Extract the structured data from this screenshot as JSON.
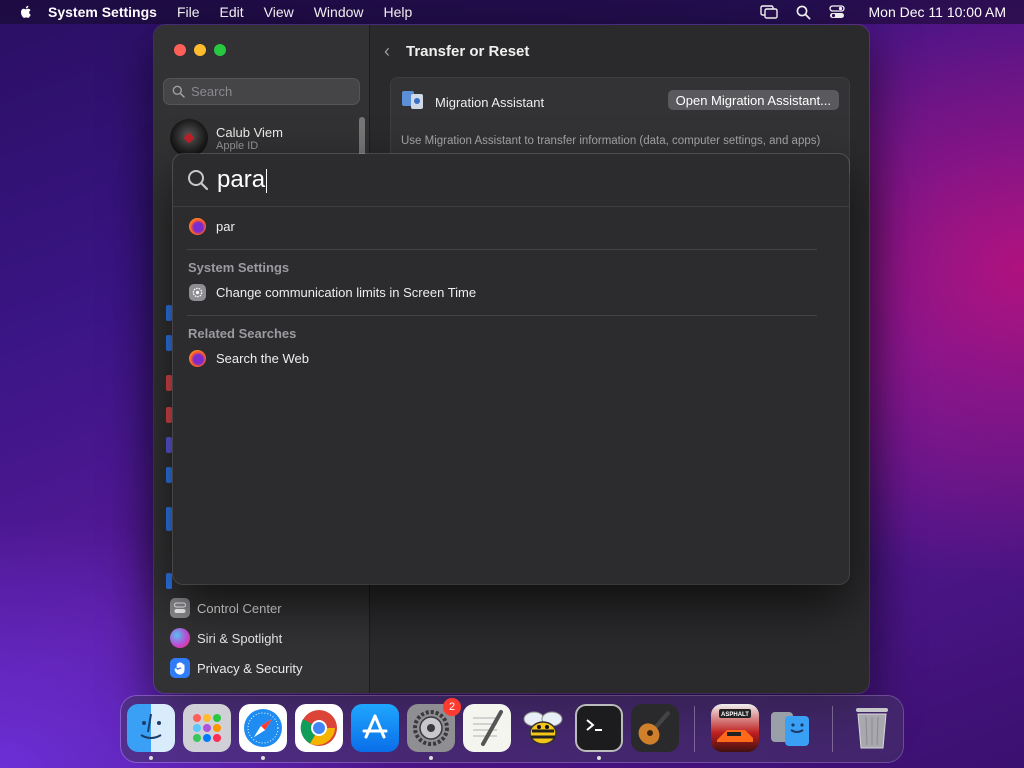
{
  "menubar": {
    "app_name": "System Settings",
    "menus": [
      "File",
      "Edit",
      "View",
      "Window",
      "Help"
    ],
    "clock": "Mon Dec 11  10:00 AM",
    "status_icons": [
      "screen-mirroring-icon",
      "spotlight-search-icon",
      "control-center-icon"
    ]
  },
  "sidebar": {
    "search_placeholder": "Search",
    "account": {
      "name": "Calub Viem",
      "subtitle": "Apple ID"
    },
    "items": [
      {
        "label": "Control Center",
        "icon": "control-center-icon",
        "color": "#8e8e93"
      },
      {
        "label": "Siri & Spotlight",
        "icon": "siri-icon",
        "color": "#c24ddb"
      },
      {
        "label": "Privacy & Security",
        "icon": "hand-icon",
        "color": "#2f7cf6"
      }
    ]
  },
  "main": {
    "title": "Transfer or Reset",
    "migration": {
      "label": "Migration Assistant",
      "button": "Open Migration Assistant...",
      "description": "Use Migration Assistant to transfer information (data, computer settings, and apps)"
    }
  },
  "spotlight": {
    "query": "para",
    "top_hit": {
      "label": "par",
      "icon": "firefox-icon"
    },
    "sections": [
      {
        "header": "System Settings",
        "items": [
          {
            "label": "Change communication limits in Screen Time",
            "icon": "settings-icon"
          }
        ]
      },
      {
        "header": "Related Searches",
        "items": [
          {
            "label": "Search the Web",
            "icon": "firefox-icon"
          }
        ]
      }
    ]
  },
  "dock": {
    "apps": [
      "Finder",
      "Launchpad",
      "Safari",
      "Google Chrome",
      "App Store",
      "System Settings",
      "TextEdit",
      "Cyberduck",
      "Terminal",
      "GarageBand",
      "Asphalt",
      "Migration Assistant",
      "Trash"
    ],
    "system_settings_badge": "2",
    "asphalt_label": "ASPHALT"
  },
  "colors": {
    "window_bg": "#2a2a2c",
    "sidebar_bg": "#323234",
    "spotlight_bg": "#2c2c2e",
    "accent": "#2f7cf6"
  }
}
